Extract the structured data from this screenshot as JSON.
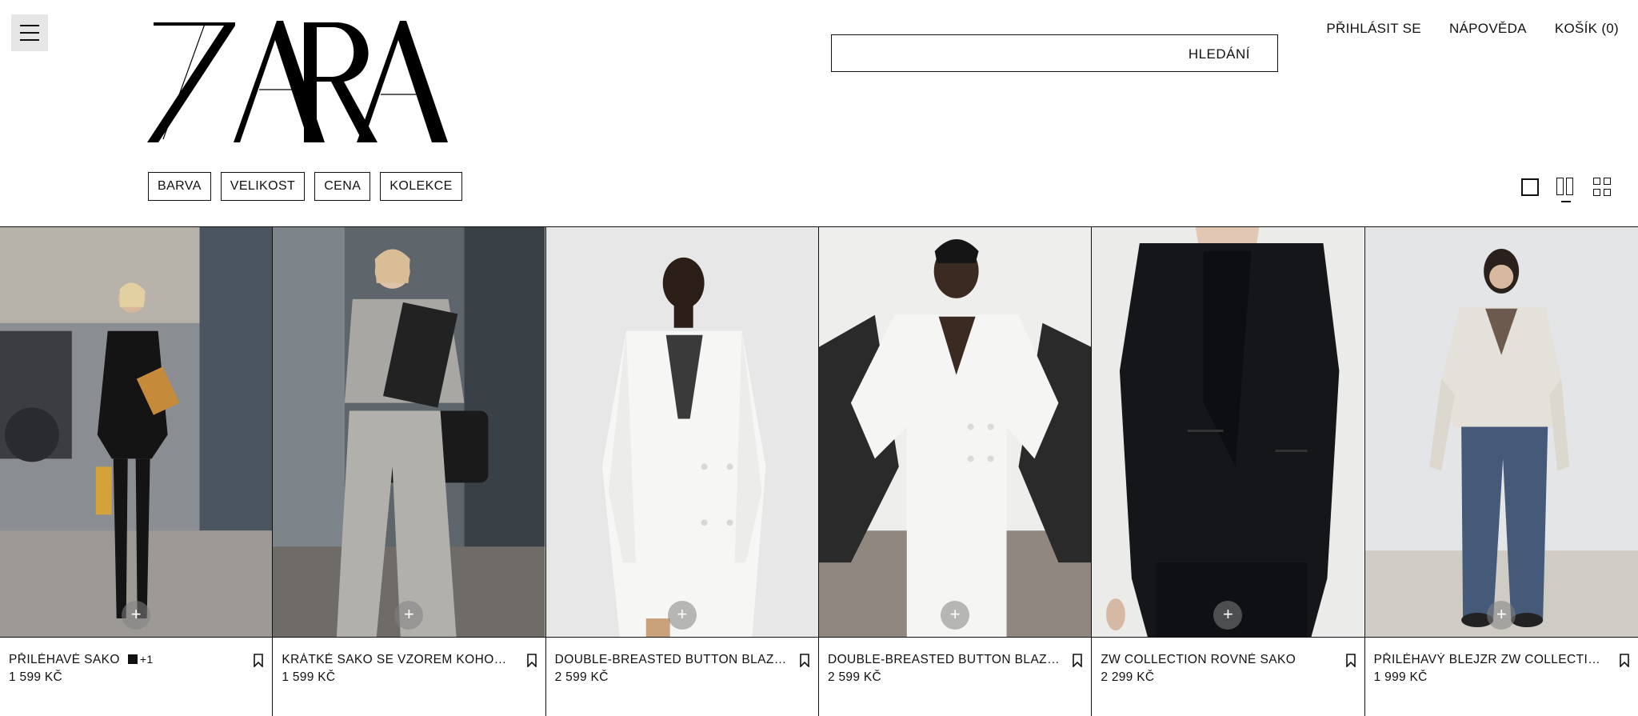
{
  "header": {
    "brand": "ZARA",
    "search_label": "HLEDÁNÍ",
    "links": [
      "PŘIHLÁSIT SE",
      "NÁPOVĚDA",
      "KOŠÍK (0)"
    ]
  },
  "filters": [
    "BARVA",
    "VELIKOST",
    "CENA",
    "KOLEKCE"
  ],
  "products": [
    {
      "name": "PŘILÉHAVÉ SAKO",
      "extra_colors": "+1",
      "price": "1 599 KČ"
    },
    {
      "name": "KRÁTKÉ SAKO SE VZOREM KOHOUTÍ ...",
      "price": "1 599 KČ"
    },
    {
      "name": "DOUBLE-BREASTED BUTTON BLAZER...",
      "price": "2 599 KČ"
    },
    {
      "name": "DOUBLE-BREASTED BUTTON BLAZER...",
      "price": "2 599 KČ"
    },
    {
      "name": "ZW COLLECTION ROVNÉ SAKO",
      "price": "2 299 KČ"
    },
    {
      "name": "PŘILÉHAVÝ BLEJZR ZW COLLECTION",
      "price": "1 999 KČ"
    }
  ],
  "add_symbol": "+",
  "colors": {
    "text": "#111111",
    "background": "#ffffff",
    "swatch": "#111111"
  }
}
